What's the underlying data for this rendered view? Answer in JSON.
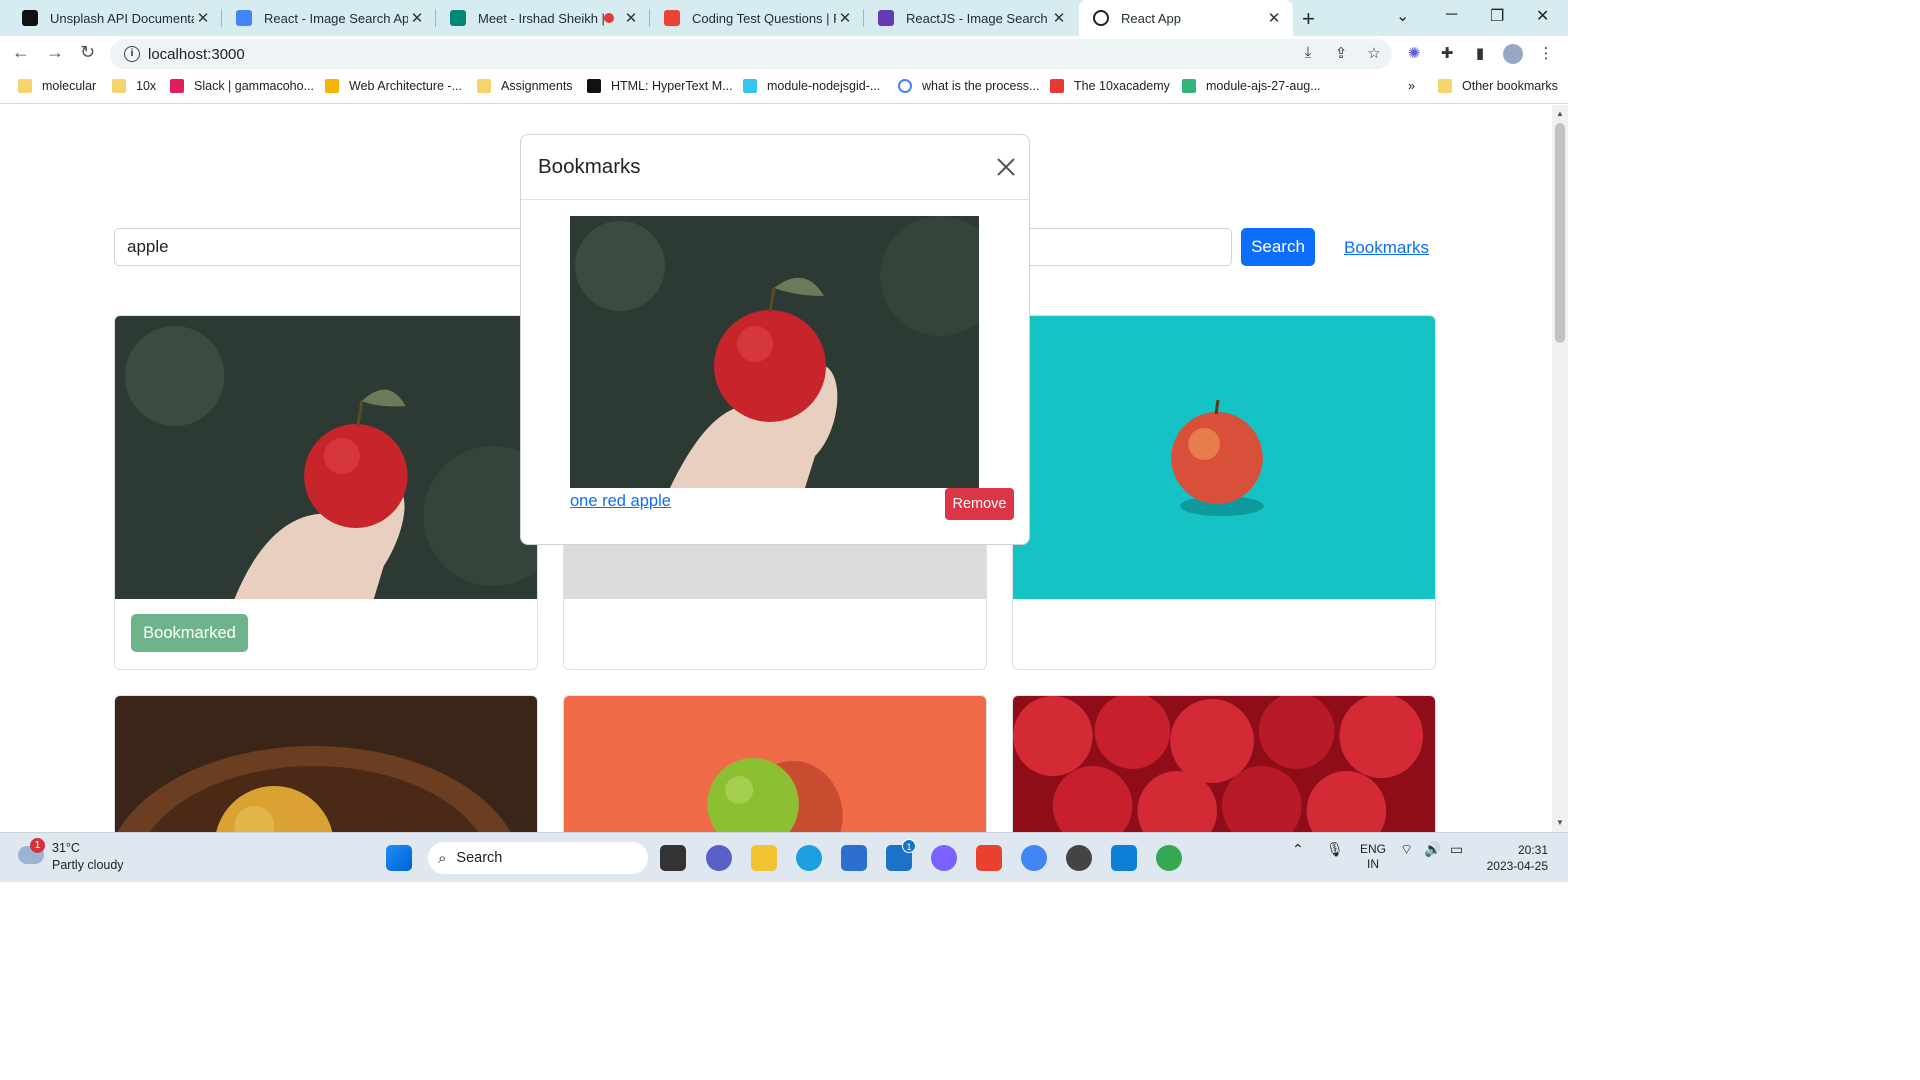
{
  "browser": {
    "tabs": [
      {
        "title": "Unsplash API Documentatio",
        "favicon_color": "#111111",
        "active": false
      },
      {
        "title": "React - Image Search App -",
        "favicon_color": "#4285f4",
        "active": false
      },
      {
        "title": "Meet - Irshad Sheikh | C",
        "favicon_color": "#00897b",
        "active": false
      },
      {
        "title": "Coding Test Questions | PRT",
        "favicon_color": "#ea4335",
        "active": false
      },
      {
        "title": "ReactJS - Image Search App",
        "favicon_color": "#673ab7",
        "active": false
      },
      {
        "title": "React App",
        "favicon_color": "#222222",
        "active": true
      }
    ],
    "new_tab_glyph": "+",
    "url": "localhost:3000",
    "bookmarks_bar": [
      {
        "label": "molecular",
        "icon": "folder-icon"
      },
      {
        "label": "10x",
        "icon": "folder-icon"
      },
      {
        "label": "Slack | gammacoho...",
        "icon": "slack-icon"
      },
      {
        "label": "Web Architecture -...",
        "icon": "slides-icon"
      },
      {
        "label": "Assignments",
        "icon": "folder-icon"
      },
      {
        "label": "HTML: HyperText M...",
        "icon": "mdn-icon"
      },
      {
        "label": "module-nodejsgid-...",
        "icon": "slack-icon"
      },
      {
        "label": "what is the process...",
        "icon": "google-icon"
      },
      {
        "label": "The 10xacademy",
        "icon": "10x-icon"
      },
      {
        "label": "module-ajs-27-aug...",
        "icon": "slack-icon"
      }
    ],
    "overflow_glyph": "»",
    "other_bookmarks": "Other bookmarks"
  },
  "app": {
    "search_value": "apple",
    "search_button": "Search",
    "bookmarks_link": "Bookmarks",
    "cards": [
      {
        "image": "apple-in-hand",
        "button": "Bookmarked",
        "image_colors": [
          "#2c3a33",
          "#c8242b"
        ]
      },
      {
        "image": "apple-white",
        "button": "",
        "image_colors": [
          "#e6e6e6",
          "#d9d9d9"
        ]
      },
      {
        "image": "apple-on-teal",
        "button": "",
        "image_colors": [
          "#15c3c5",
          "#d9503a"
        ]
      },
      {
        "image": "apple-in-bowl",
        "button": "",
        "image_colors": [
          "#3b2418",
          "#d9a233"
        ]
      },
      {
        "image": "green-apple-orange-bg",
        "button": "",
        "image_colors": [
          "#ef6a47",
          "#8dbf33"
        ]
      },
      {
        "image": "red-apples-pile",
        "button": "",
        "image_colors": [
          "#8e0d18",
          "#d42a36"
        ]
      }
    ]
  },
  "modal": {
    "title": "Bookmarks",
    "items": [
      {
        "caption": "one red apple",
        "remove_label": "Remove",
        "image": "apple-in-hand"
      }
    ]
  },
  "colors": {
    "primary": "#0d6efd",
    "danger": "#dc3545",
    "success_faded": "#6fb38c"
  },
  "taskbar": {
    "weather_temp": "31°C",
    "weather_cond": "Partly cloudy",
    "weather_badge": "1",
    "search_label": "Search",
    "mail_badge": "1",
    "lang_top": "ENG",
    "lang_bottom": "IN",
    "time": "20:31",
    "date": "2023-04-25"
  }
}
